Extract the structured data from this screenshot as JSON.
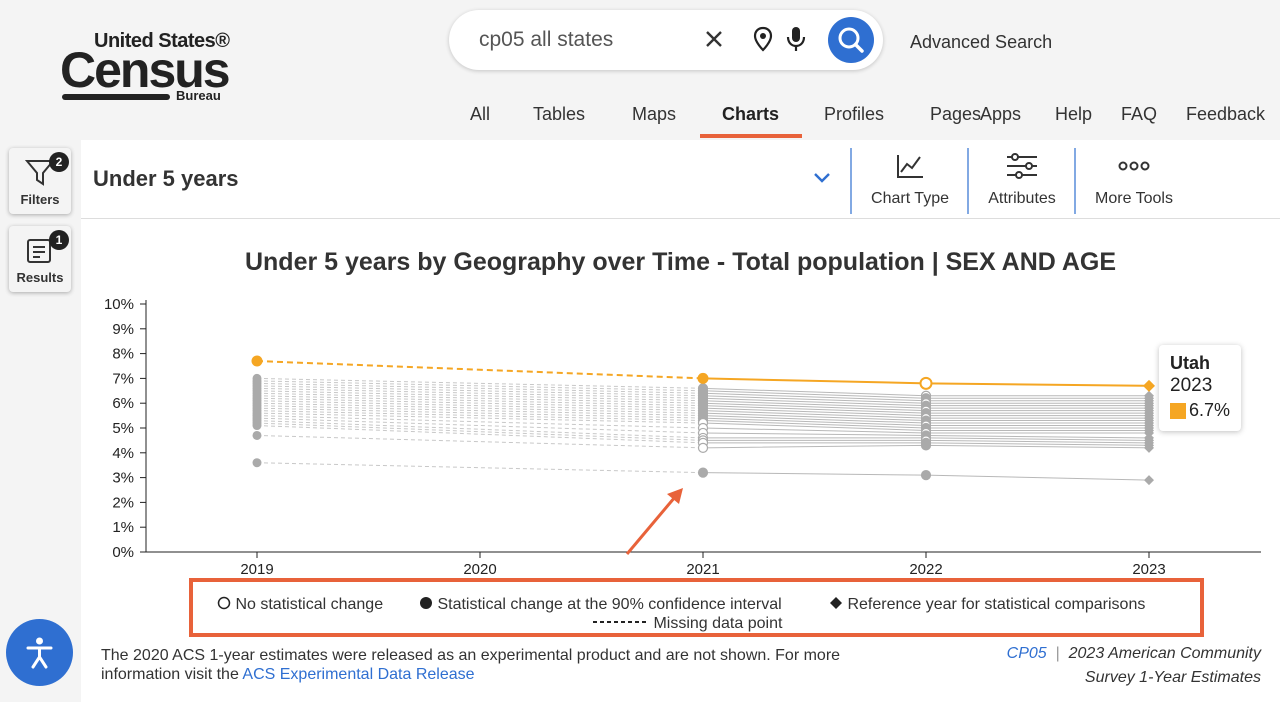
{
  "header": {
    "logo": {
      "line1": "United States®",
      "line2": "Census",
      "line3": "Bureau"
    },
    "search": {
      "value": "cp05 all states",
      "placeholder": ""
    },
    "advanced_search": "Advanced Search",
    "nav": [
      "All",
      "Tables",
      "Maps",
      "Charts",
      "Profiles",
      "Pages",
      "Apps",
      "Help",
      "FAQ",
      "Feedback"
    ],
    "active_nav": "Charts"
  },
  "sidebar": {
    "filters": {
      "label": "Filters",
      "count": "2"
    },
    "results": {
      "label": "Results",
      "count": "1"
    }
  },
  "toolbar": {
    "variable": "Under 5 years",
    "chart_type": "Chart Type",
    "attributes": "Attributes",
    "more_tools": "More Tools"
  },
  "chart_data": {
    "type": "line",
    "title": "Under 5 years by Geography over Time - Total population | SEX AND AGE",
    "x": [
      "2019",
      "2020",
      "2021",
      "2022",
      "2023"
    ],
    "y_ticks": [
      "0%",
      "1%",
      "2%",
      "3%",
      "4%",
      "5%",
      "6%",
      "7%",
      "8%",
      "9%",
      "10%"
    ],
    "ylim": [
      0,
      10
    ],
    "grid": false,
    "highlight_series": {
      "name": "Utah",
      "values": [
        7.7,
        null,
        7.0,
        6.8,
        6.7
      ],
      "color": "#f5a623"
    },
    "background_series_2019": [
      7.0,
      6.9,
      6.8,
      6.7,
      6.6,
      6.5,
      6.4,
      6.3,
      6.2,
      6.1,
      6.0,
      5.9,
      5.8,
      5.7,
      5.6,
      5.5,
      5.4,
      5.3,
      5.2,
      5.1,
      4.7,
      3.6
    ],
    "background_series_2021": [
      6.6,
      6.5,
      6.4,
      6.3,
      6.2,
      6.1,
      6.0,
      5.9,
      5.8,
      5.7,
      5.6,
      5.5,
      5.4,
      5.3,
      5.2,
      5.0,
      4.8,
      4.6,
      4.5,
      4.4,
      4.2,
      3.2
    ],
    "background_series_2022": [
      6.3,
      6.2,
      6.1,
      6.0,
      5.9,
      5.8,
      5.7,
      5.6,
      5.5,
      5.4,
      5.3,
      5.2,
      5.1,
      5.0,
      4.9,
      4.8,
      4.7,
      4.6,
      4.5,
      4.4,
      4.3,
      3.1
    ],
    "background_series_2023": [
      6.3,
      6.2,
      6.1,
      6.0,
      5.9,
      5.8,
      5.7,
      5.6,
      5.5,
      5.4,
      5.3,
      5.2,
      5.1,
      5.0,
      4.9,
      4.8,
      4.6,
      4.5,
      4.4,
      4.3,
      4.2,
      2.9
    ],
    "background_color": "#aaaaaa",
    "tooltip": {
      "name": "Utah",
      "year": "2023",
      "value": "6.7%"
    }
  },
  "legend": {
    "no_change": "No statistical change",
    "change": "Statistical change at the 90% confidence interval",
    "reference": "Reference year for statistical comparisons",
    "missing": "Missing data point"
  },
  "footnote": {
    "text": "The 2020 ACS 1-year estimates were released as an experimental product and are not shown. For more information visit the ",
    "link": "ACS Experimental Data Release"
  },
  "source": {
    "code": "CP05",
    "line1": "2023 American Community",
    "line2": "Survey 1-Year Estimates"
  },
  "colors": {
    "accent": "#2f6fd1",
    "highlight": "#e8623a",
    "utah": "#f5a623"
  }
}
